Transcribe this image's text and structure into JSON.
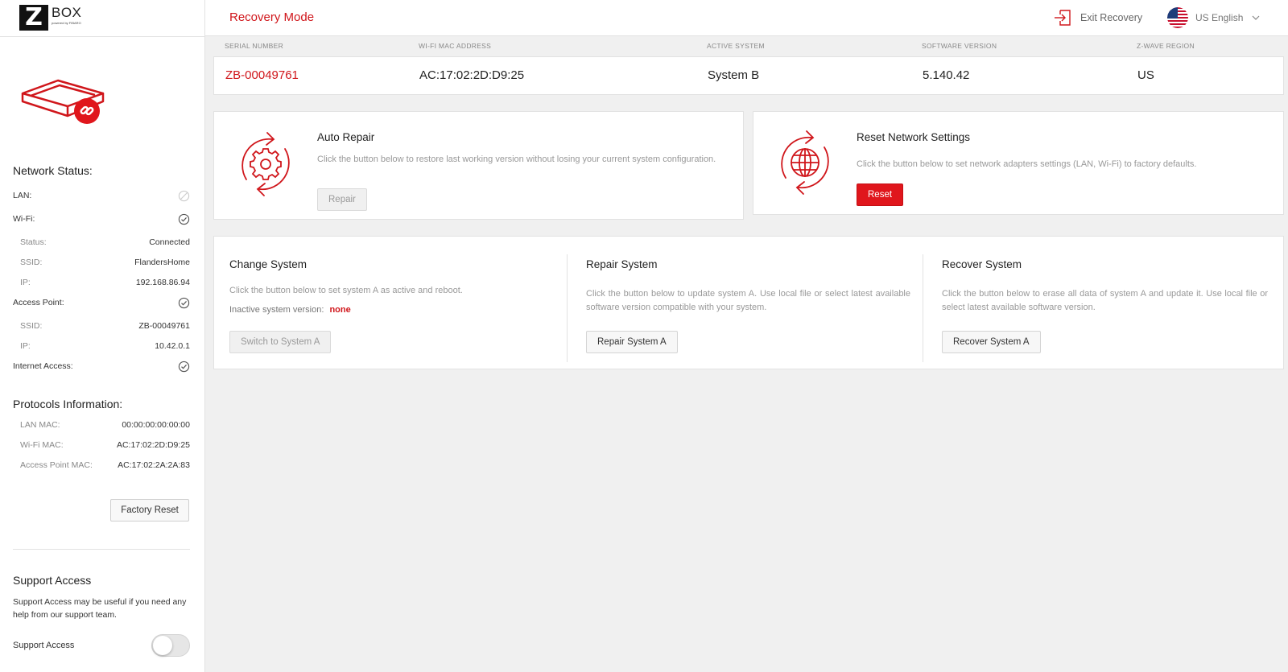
{
  "brand": {
    "logo_letter": "Z",
    "logo_word": "BOX",
    "logo_tagline": "powered by FIBARO"
  },
  "header": {
    "title": "Recovery Mode",
    "exit_label": "Exit Recovery",
    "language": "US English"
  },
  "info": {
    "labels": [
      "SERIAL NUMBER",
      "WI-FI MAC ADDRESS",
      "ACTIVE SYSTEM",
      "SOFTWARE VERSION",
      "Z-WAVE REGION"
    ],
    "serial": "ZB-00049761",
    "wifi_mac": "AC:17:02:2D:D9:25",
    "active_system": "System B",
    "software_version": "5.140.42",
    "zwave_region": "US"
  },
  "sidebar": {
    "network_title": "Network Status:",
    "lan_label": "LAN:",
    "wifi_label": "Wi-Fi:",
    "wifi_status_label": "Status:",
    "wifi_status_value": "Connected",
    "wifi_ssid_label": "SSID:",
    "wifi_ssid_value": "FlandersHome",
    "wifi_ip_label": "IP:",
    "wifi_ip_value": "192.168.86.94",
    "ap_label": "Access Point:",
    "ap_ssid_label": "SSID:",
    "ap_ssid_value": "ZB-00049761",
    "ap_ip_label": "IP:",
    "ap_ip_value": "10.42.0.1",
    "internet_label": "Internet Access:",
    "protocols_title": "Protocols Information:",
    "lan_mac_label": "LAN MAC:",
    "lan_mac_value": "00:00:00:00:00:00",
    "wifi_mac_label": "Wi-Fi MAC:",
    "wifi_mac_value": "AC:17:02:2D:D9:25",
    "ap_mac_label": "Access Point MAC:",
    "ap_mac_value": "AC:17:02:2A:2A:83",
    "factory_reset": "Factory Reset",
    "support_title": "Support Access",
    "support_desc": "Support Access may be useful if you need any help from our support team.",
    "support_toggle_label": "Support Access"
  },
  "auto_repair": {
    "title": "Auto Repair",
    "desc": "Click the button below to restore last working version without losing your current system configuration.",
    "button": "Repair"
  },
  "reset_network": {
    "title": "Reset Network Settings",
    "desc": "Click the button below to set network adapters settings (LAN, Wi-Fi) to factory defaults.",
    "button": "Reset"
  },
  "change_system": {
    "title": "Change System",
    "desc": "Click the button below to set system A as active and reboot.",
    "inactive_label": "Inactive system version:",
    "inactive_value": "none",
    "button": "Switch to System A"
  },
  "repair_system": {
    "title": "Repair System",
    "desc": "Click the button below to update system A. Use local file or select latest available software version compatible with your system.",
    "button": "Repair System A"
  },
  "recover_system": {
    "title": "Recover System",
    "desc": "Click the button below to erase all data of system A and update it. Use local file or select latest available software version.",
    "button": "Recover System A"
  },
  "colors": {
    "accent": "#d0161b",
    "muted_text": "#999999",
    "border": "#e2e2e2"
  },
  "icons": [
    "device-icon",
    "check-circle-icon",
    "disabled-circle-icon",
    "exit-icon",
    "us-flag-icon",
    "chevron-down-icon",
    "gear-refresh-icon",
    "globe-refresh-icon"
  ]
}
